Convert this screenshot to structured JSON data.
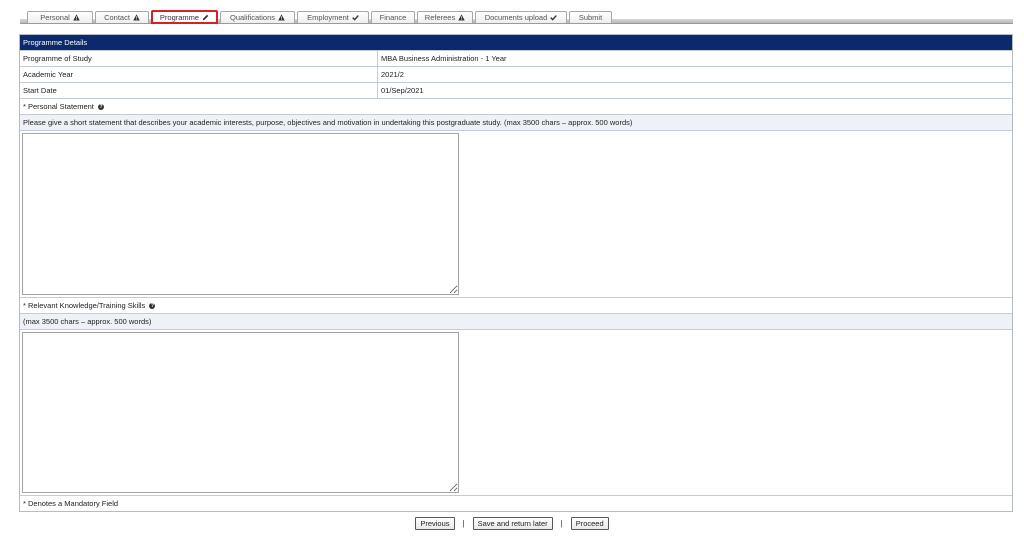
{
  "tabs": [
    {
      "label": "Personal",
      "icon": "warning-icon"
    },
    {
      "label": "Contact",
      "icon": "warning-icon"
    },
    {
      "label": "Programme",
      "icon": "pencil-icon",
      "active": true
    },
    {
      "label": "Qualifications",
      "icon": "warning-icon"
    },
    {
      "label": "Employment",
      "icon": "check-icon"
    },
    {
      "label": "Finance",
      "icon": ""
    },
    {
      "label": "Referees",
      "icon": "warning-icon"
    },
    {
      "label": "Documents upload",
      "icon": "check-icon"
    },
    {
      "label": "Submit",
      "icon": ""
    }
  ],
  "programme": {
    "section_title": "Programme Details",
    "rows": [
      {
        "label": "Programme of Study",
        "value": "MBA Business Administration - 1 Year"
      },
      {
        "label": "Academic Year",
        "value": "2021/2"
      },
      {
        "label": "Start Date",
        "value": "01/Sep/2021"
      }
    ]
  },
  "personal_statement": {
    "label": "* Personal Statement",
    "help_icon": "question-circle-icon",
    "instructions": "Please give a short statement that describes your academic interests, purpose, objectives and motivation in undertaking this postgraduate study. (max 3500 chars – approx. 500 words)",
    "value": ""
  },
  "knowledge_skills": {
    "label": "* Relevant Knowledge/Training Skills",
    "help_icon": "question-circle-icon",
    "instructions": "(max 3500 chars – approx. 500 words)",
    "value": ""
  },
  "footer_note": "* Denotes a Mandatory Field",
  "actions": {
    "previous": "Previous",
    "separator": "|",
    "save": "Save and return later",
    "proceed": "Proceed"
  },
  "colors": {
    "header_bg": "#0c2a6b",
    "active_tab_border": "#d42027",
    "light_row_bg": "#eef2f8"
  }
}
